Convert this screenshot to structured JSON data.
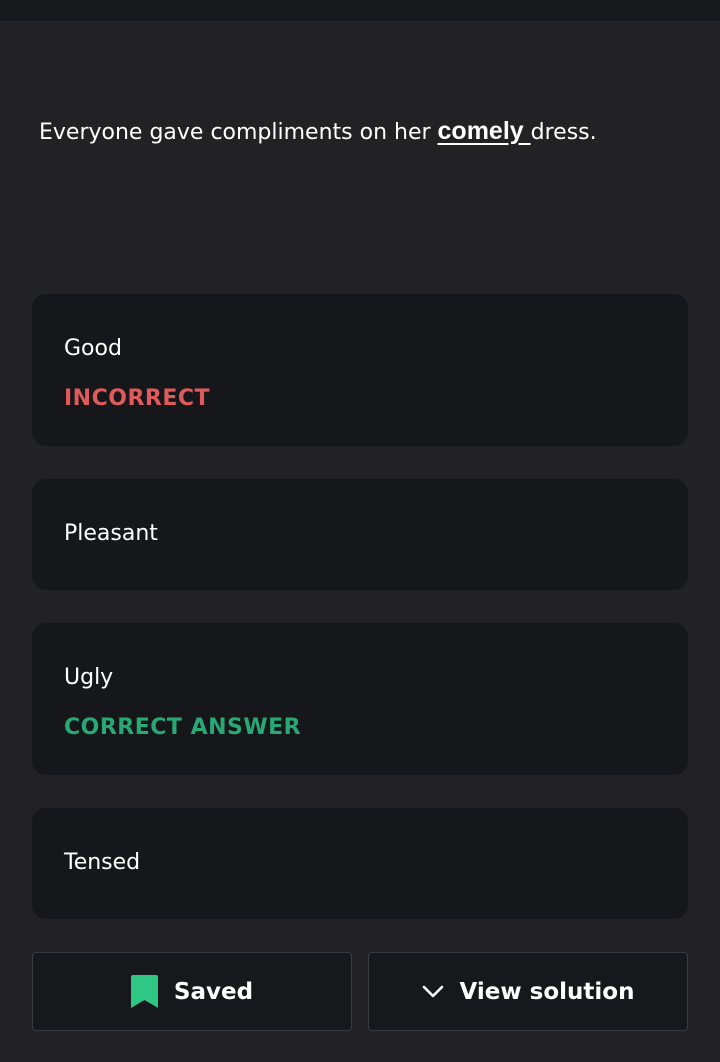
{
  "question": {
    "before": "Everyone gave compliments on her ",
    "keyword": "comely ",
    "after": "dress."
  },
  "options": [
    {
      "label": "Good",
      "status": "INCORRECT"
    },
    {
      "label": "Pleasant",
      "status": ""
    },
    {
      "label": "Ugly",
      "status": "CORRECT ANSWER"
    },
    {
      "label": "Tensed",
      "status": ""
    }
  ],
  "actions": {
    "saved_label": "Saved",
    "saved_icon": "bookmark-icon",
    "view_solution_label": "View solution",
    "view_solution_icon": "chevron-down-icon"
  },
  "colors": {
    "incorrect": "#e05a5a",
    "correct": "#27a874",
    "bookmark": "#2fc784"
  }
}
